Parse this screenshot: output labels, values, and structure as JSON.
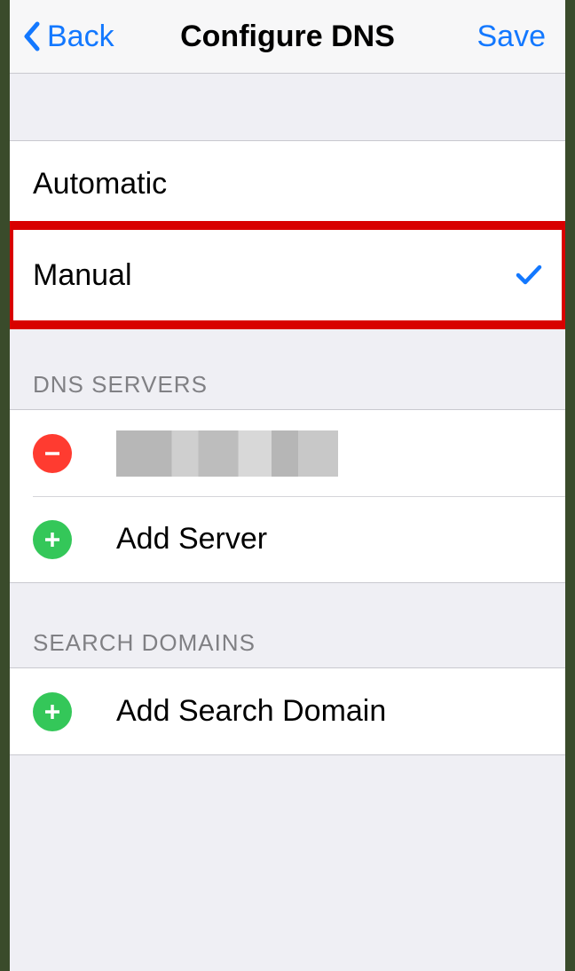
{
  "nav": {
    "back_label": "Back",
    "title": "Configure DNS",
    "save_label": "Save"
  },
  "options": {
    "automatic": {
      "label": "Automatic",
      "selected": false
    },
    "manual": {
      "label": "Manual",
      "selected": true
    }
  },
  "dns_servers": {
    "header": "DNS SERVERS",
    "items": [
      {
        "value": "[redacted]",
        "redacted": true
      }
    ],
    "add_label": "Add Server"
  },
  "search_domains": {
    "header": "SEARCH DOMAINS",
    "add_label": "Add Search Domain"
  },
  "annotation": {
    "highlighted_option": "manual"
  },
  "colors": {
    "accent": "#1378ff",
    "delete": "#ff3b30",
    "add": "#34c759",
    "highlight_box": "#d80000"
  }
}
